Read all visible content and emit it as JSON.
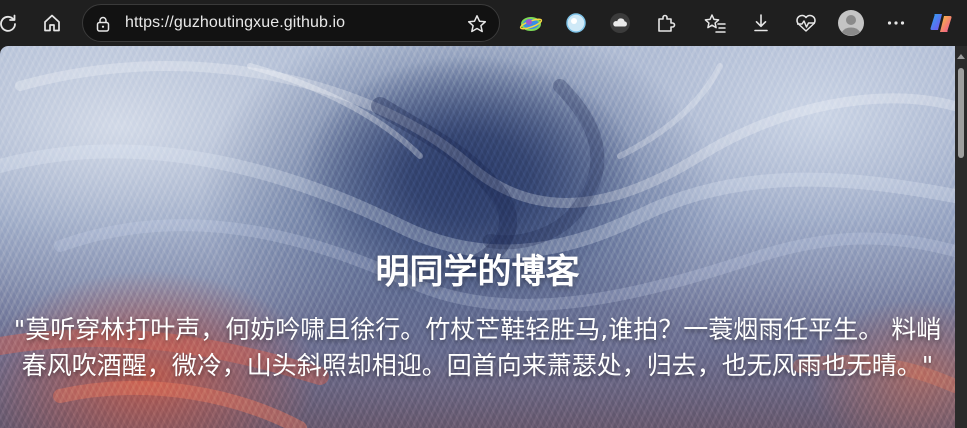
{
  "browser": {
    "url": "https://guzhoutingxue.github.io",
    "colors": {
      "toolbar_bg": "#1f1f1f",
      "address_bg": "#121212",
      "text": "#e8e8e8"
    },
    "toolbar_left": [
      {
        "name": "reload-icon",
        "label": "reload"
      },
      {
        "name": "home-icon",
        "label": "home"
      }
    ],
    "address_icons": [
      "lock-icon",
      "favorite-star-icon"
    ],
    "toolbar_right": [
      "extension-globe-icon",
      "extension-circle-icon",
      "extension-cloud-icon",
      "extensions-puzzle-icon",
      "favorites-list-icon",
      "downloads-icon",
      "browser-essentials-heart-icon",
      "profile-avatar-icon",
      "more-menu-icon",
      "copilot-icon"
    ]
  },
  "page": {
    "title": "明同学的博客",
    "quote": "\"莫听穿林打叶声，何妨吟啸且徐行。竹杖芒鞋轻胜马,谁拍？一蓑烟雨任平生。 料峭春风吹酒醒，微冷，山头斜照却相迎。回首向来萧瑟处，归去，也无风雨也无晴。\"",
    "colors": {
      "title": "#ffffff",
      "accent_swirl": "#2f3f6a",
      "accent_warm": "#c85a46"
    }
  }
}
